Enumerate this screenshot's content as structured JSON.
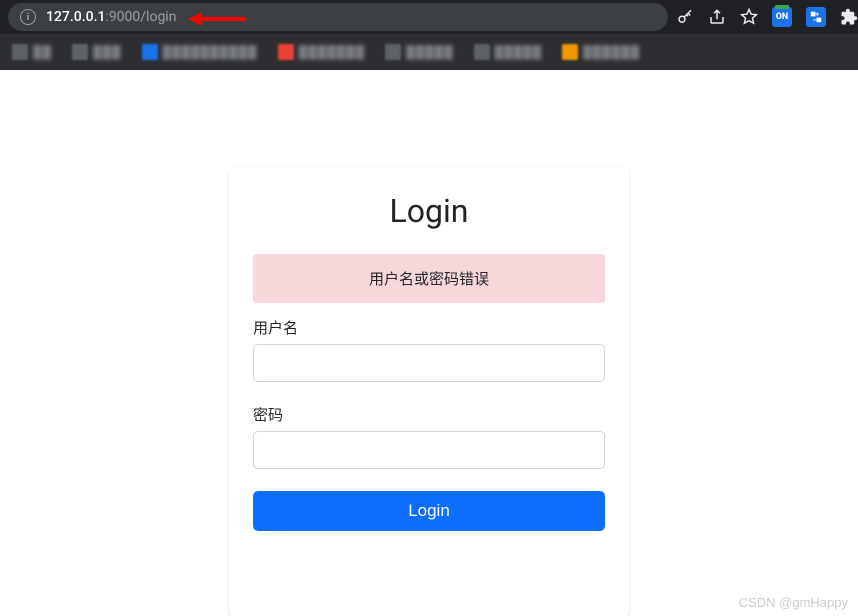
{
  "browser": {
    "url_host": "127.0.0.1",
    "url_port_path": ":9000/login",
    "extension_on_label": "ON",
    "extension_translate_label": "☯"
  },
  "bookmarks": {
    "items": [
      {
        "glyph": "folder",
        "label": "██"
      },
      {
        "glyph": "folder",
        "label": "███"
      },
      {
        "glyph": "blue",
        "label": "██████████"
      },
      {
        "glyph": "red",
        "label": "███████"
      },
      {
        "glyph": "grey",
        "label": "█████"
      },
      {
        "glyph": "grey",
        "label": "█████"
      },
      {
        "glyph": "orange",
        "label": "██████"
      }
    ]
  },
  "login": {
    "title": "Login",
    "error_message": "用户名或密码错误",
    "username_label": "用户名",
    "password_label": "密码",
    "username_value": "",
    "password_value": "",
    "submit_label": "Login"
  },
  "watermark": "CSDN @gmHappy",
  "colors": {
    "primary": "#0d6efd",
    "alert_bg": "#f8d7da"
  }
}
